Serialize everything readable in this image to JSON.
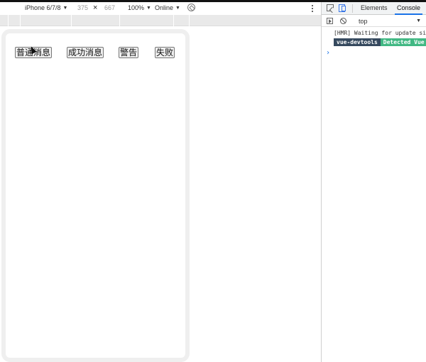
{
  "device_toolbar": {
    "device_name": "iPhone 6/7/8",
    "width": "375",
    "times": "×",
    "height": "667",
    "zoom": "100%",
    "network": "Online"
  },
  "demo_buttons": [
    {
      "label": "普通消息"
    },
    {
      "label": "成功消息"
    },
    {
      "label": "警告"
    },
    {
      "label": "失败"
    }
  ],
  "devtools": {
    "tabs": {
      "elements": "Elements",
      "console": "Console"
    },
    "context": "top",
    "console_lines": {
      "hmr": "[HMR] Waiting for update si",
      "badge_dark": "vue-devtools",
      "badge_green": "Detected Vue"
    },
    "prompt": "›"
  },
  "colors": {
    "accent": "#1a73e8",
    "vue_dark": "#35495e",
    "vue_green": "#41b883",
    "frame": "#efefef"
  }
}
